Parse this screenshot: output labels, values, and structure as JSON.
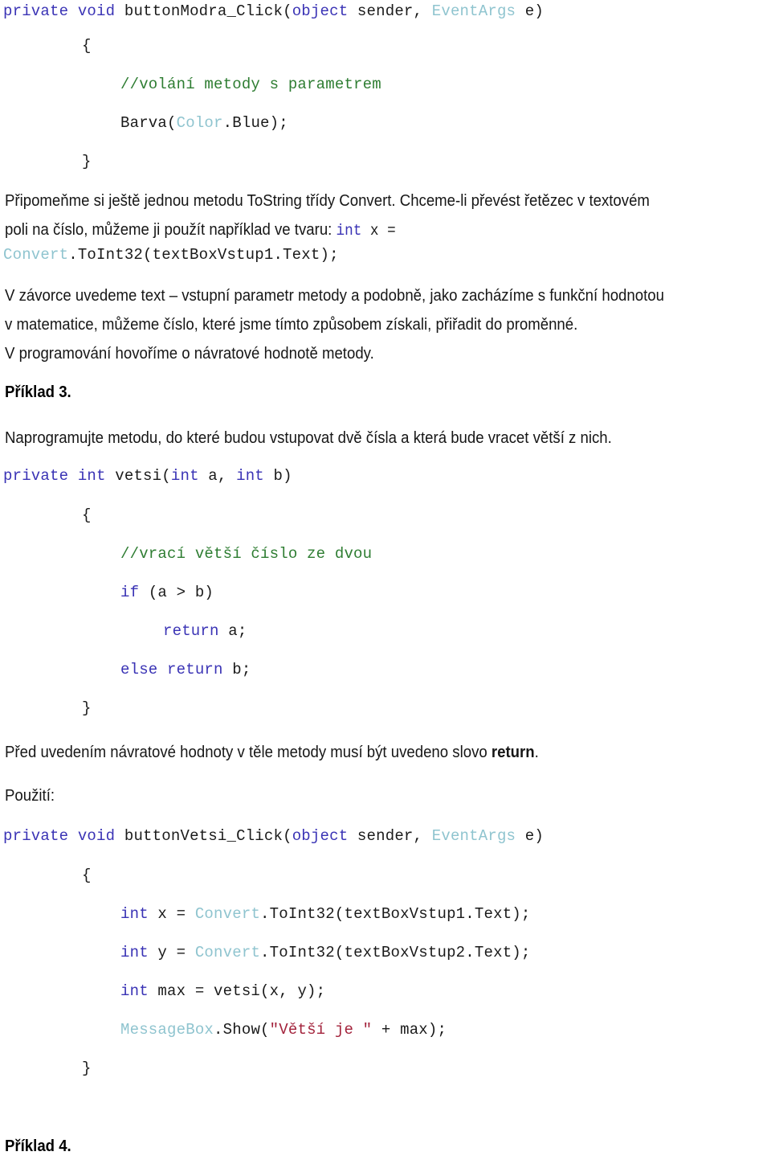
{
  "document": {
    "language": "cs",
    "page_background": "#ffffff",
    "syntax_colors": {
      "keyword": "#3a33b5",
      "type": "#8fc4cf",
      "comment": "#2e7d32",
      "string": "#a3233c",
      "plain": "#1a1a1a"
    }
  },
  "code_block_1": {
    "line1_kw1": "private",
    "line1_kw2": "void",
    "line1_name": " buttonModra_Click(",
    "line1_kw3": "object",
    "line1_mid": " sender, ",
    "line1_type": "EventArgs",
    "line1_end": " e)",
    "line2_brace": "{",
    "line3_comment": "//volání metody s parametrem",
    "line4_call_pre": "Barva(",
    "line4_type": "Color",
    "line4_post": ".Blue);",
    "line5_brace": "}"
  },
  "paragraph_1": {
    "line1": "Připomeňme si ještě jednou metodu ToString třídy Convert. Chceme-li převést řetězec v textovém",
    "line2_pre": "poli na číslo, můžeme ji použít například ve tvaru: ",
    "line2_kw": "int",
    "line2_var": " x =",
    "line3_type": "Convert",
    "line3_rest": ".ToInt32(textBoxVstup1.Text);"
  },
  "paragraph_2": {
    "line1": "V závorce uvedeme text – vstupní parametr metody a podobně, jako zacházíme s funkční hodnotou",
    "line2": "v matematice, můžeme číslo, které jsme tímto způsobem získali, přiřadit do proměnné.",
    "line3": "V programování hovoříme o návratové hodnotě metody."
  },
  "example_3": {
    "heading": "Příklad 3.",
    "task": "Naprogramujte metodu, do které budou vstupovat dvě čísla a která bude vracet větší z nich."
  },
  "code_block_2": {
    "line1_kw1": "private",
    "line1_kw2": "int",
    "line1_name": " vetsi(",
    "line1_kw3": "int",
    "line1_a": " a, ",
    "line1_kw4": "int",
    "line1_b": " b)",
    "line2_brace": "{",
    "line3_comment": "//vrací větší číslo ze dvou",
    "line4_kw": "if",
    "line4_cond": " (a > b)",
    "line5_kw": "return",
    "line5_val": " a;",
    "line6_kw1": "else",
    "line6_kw2": " return",
    "line6_val": " b;",
    "line7_brace": "}"
  },
  "paragraph_3": {
    "line1_pre": "Před uvedením návratové hodnoty v těle metody musí být uvedeno slovo ",
    "line1_bold": "return",
    "line1_post": "."
  },
  "usage_label": "Použití:",
  "code_block_3": {
    "line1_kw1": "private",
    "line1_kw2": "void",
    "line1_name": " buttonVetsi_Click(",
    "line1_kw3": "object",
    "line1_mid": " sender, ",
    "line1_type": "EventArgs",
    "line1_end": " e)",
    "line2_brace": "{",
    "line3_kw": "int",
    "line3_var": " x = ",
    "line3_type": "Convert",
    "line3_rest": ".ToInt32(textBoxVstup1.Text);",
    "line4_kw": "int",
    "line4_var": " y = ",
    "line4_type": "Convert",
    "line4_rest": ".ToInt32(textBoxVstup2.Text);",
    "line5_kw": "int",
    "line5_rest": " max = vetsi(x, y);",
    "line6_type": "MessageBox",
    "line6_pre": ".Show(",
    "line6_str": "\"Větší je \"",
    "line6_post": " + max);",
    "line7_brace": "}"
  },
  "example_4": {
    "heading": "Příklad 4."
  }
}
